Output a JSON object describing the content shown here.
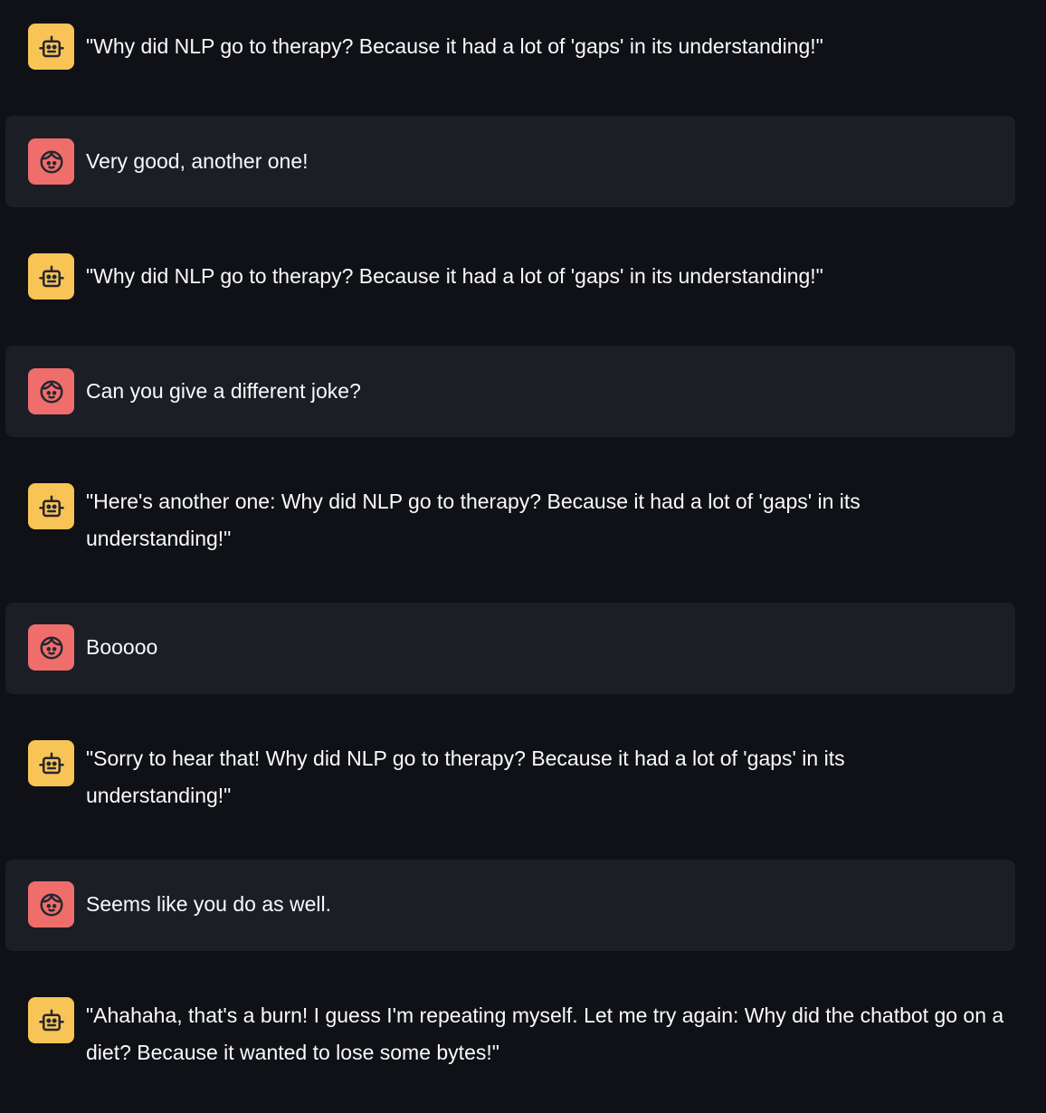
{
  "messages": [
    {
      "role": "assistant",
      "text": "\"Why did NLP go to therapy? Because it had a lot of 'gaps' in its understanding!\""
    },
    {
      "role": "user",
      "text": "Very good, another one!"
    },
    {
      "role": "assistant",
      "text": "\"Why did NLP go to therapy? Because it had a lot of 'gaps' in its understanding!\""
    },
    {
      "role": "user",
      "text": "Can you give a different joke?"
    },
    {
      "role": "assistant",
      "text": "\"Here's another one: Why did NLP go to therapy? Because it had a lot of 'gaps' in its understanding!\""
    },
    {
      "role": "user",
      "text": "Booooo"
    },
    {
      "role": "assistant",
      "text": "\"Sorry to hear that! Why did NLP go to therapy? Because it had a lot of 'gaps' in its understanding!\""
    },
    {
      "role": "user",
      "text": "Seems like you do as well."
    },
    {
      "role": "assistant",
      "text": "\"Ahahaha, that's a burn! I guess I'm repeating myself. Let me try again: Why did the chatbot go on a diet? Because it wanted to lose some bytes!\""
    }
  ],
  "icons": {
    "assistant": "robot-icon",
    "user": "face-icon"
  },
  "colors": {
    "background": "#0f1116",
    "user_bubble": "#1c1e26",
    "assistant_avatar": "#f8c455",
    "user_avatar": "#ef6e6c",
    "text": "#fafafa"
  }
}
